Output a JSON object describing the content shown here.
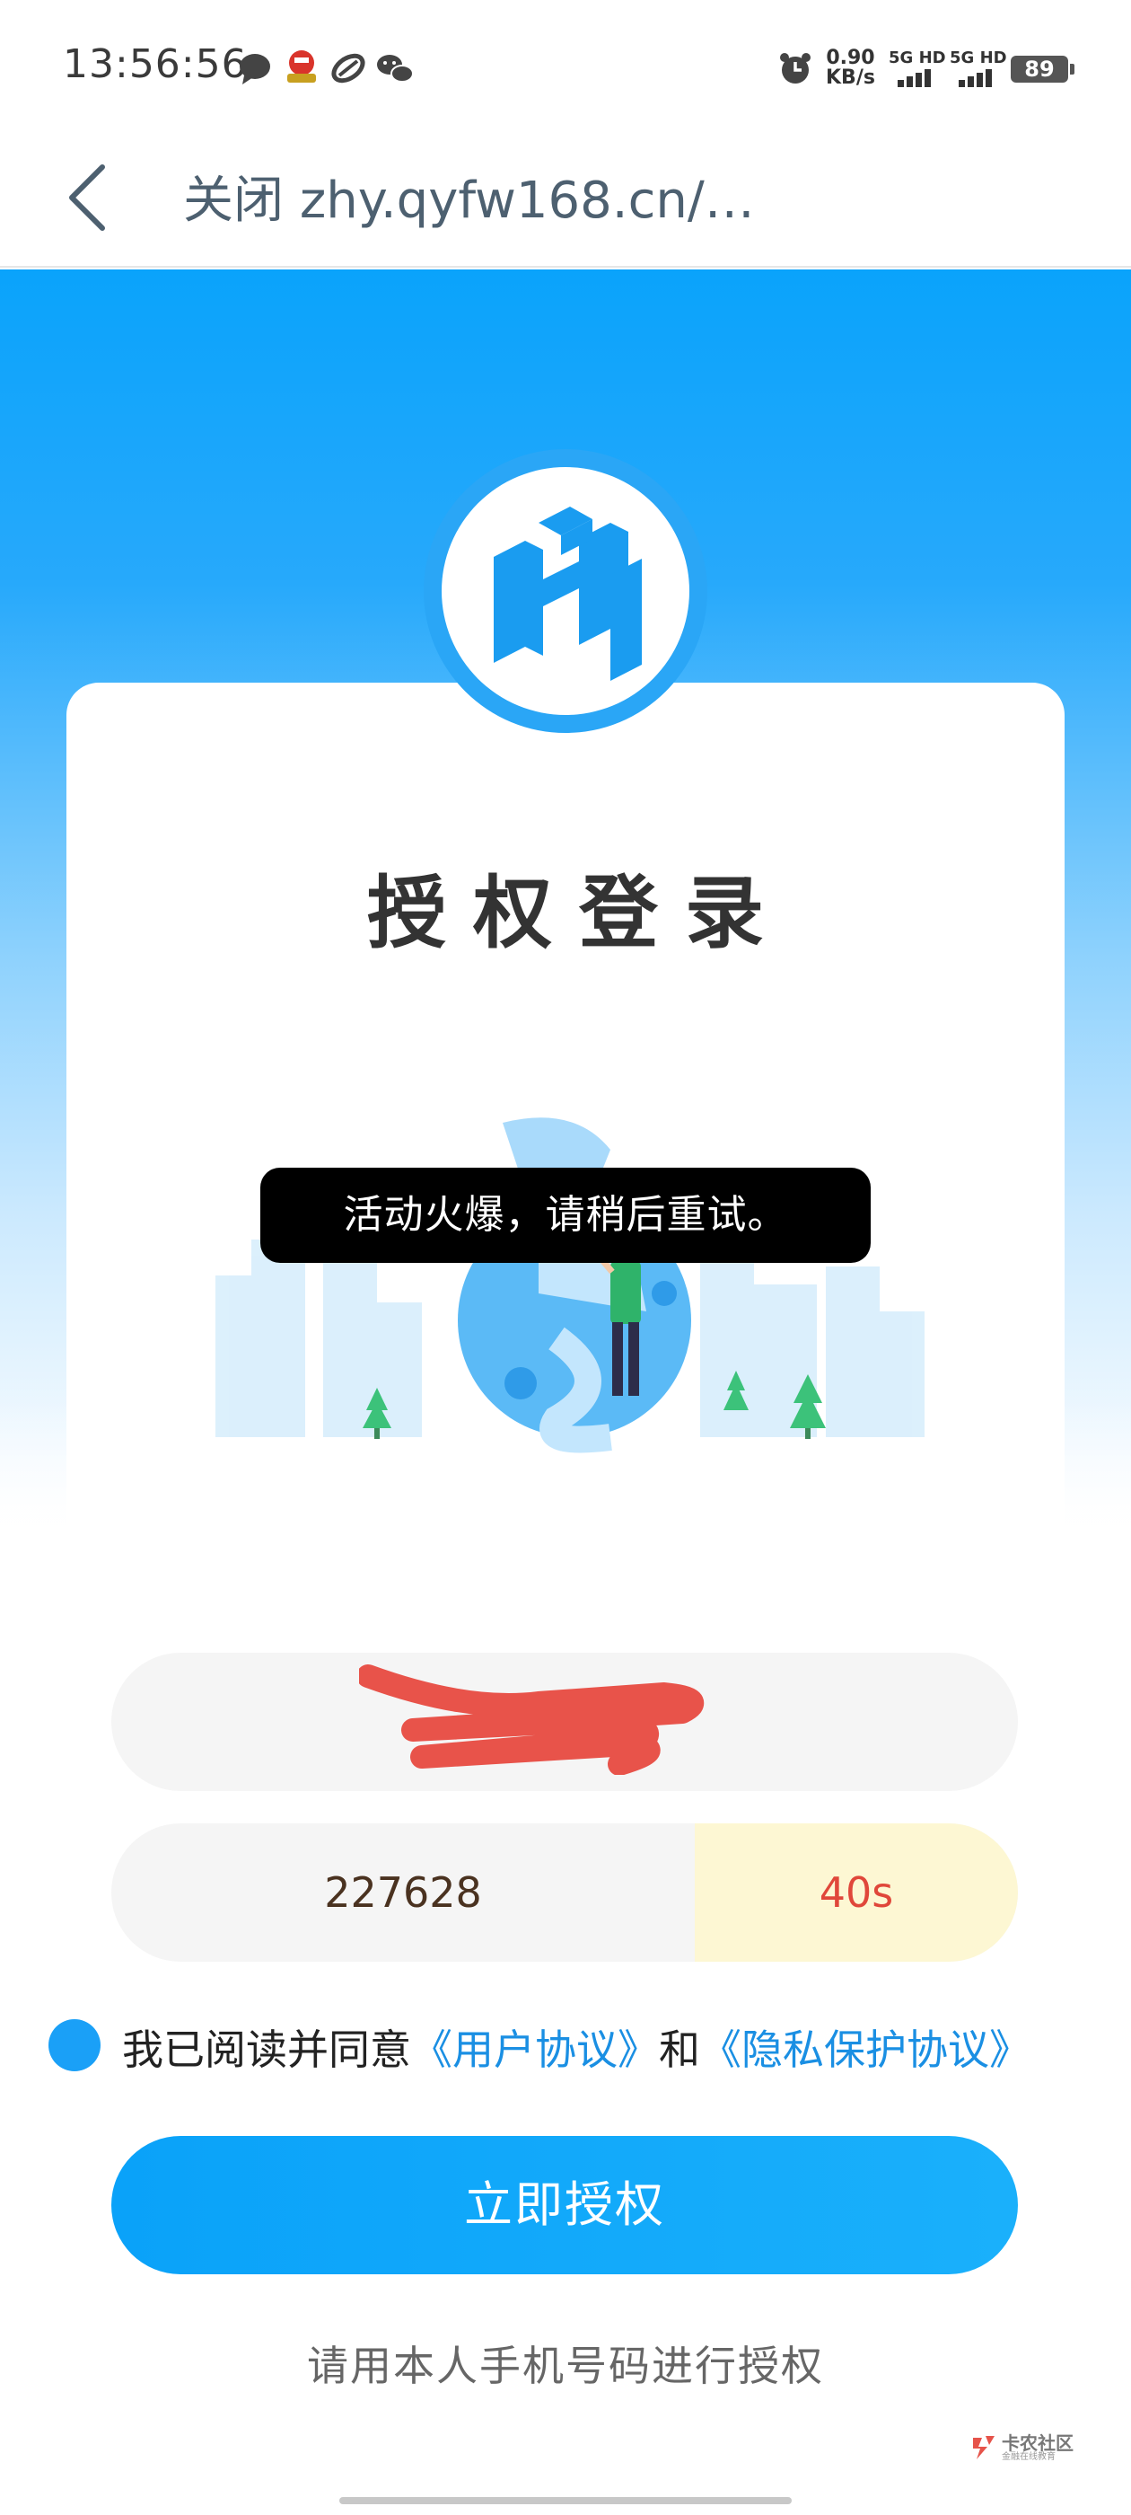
{
  "status_bar": {
    "time": "13:56:56",
    "net_speed_value": "0.90",
    "net_speed_unit": "KB/s",
    "signal1": "5G HD",
    "signal2": "5G HD",
    "battery": "89",
    "icons": [
      "message-icon",
      "app-icon",
      "link-icon",
      "wechat-icon",
      "alarm-icon"
    ]
  },
  "nav": {
    "close_label": "关闭",
    "url": "zhy.qyfw168.cn/…",
    "back_icon": "chevron-left-icon"
  },
  "header": {
    "title": "授权登录",
    "logo": "hh-logo-icon"
  },
  "toast": {
    "message": "活动火爆，请稍后重试。"
  },
  "form": {
    "phone_value_redacted": true,
    "code_value": "227628",
    "countdown": "40s",
    "agree_prefix": "我已阅读并同意",
    "user_agreement": "《用户协议》",
    "and": "和",
    "privacy_agreement": "《隐私保护协议》",
    "submit_label": "立即授权",
    "hint": "请用本人手机号码进行授权"
  },
  "watermark": {
    "text": "卡农社区",
    "sub": "金融在线教育"
  },
  "colors": {
    "primary": "#0aa3fb",
    "countdown_bg": "#fdf7d3",
    "countdown_text": "#e0473a",
    "link": "#1a8fe3"
  }
}
